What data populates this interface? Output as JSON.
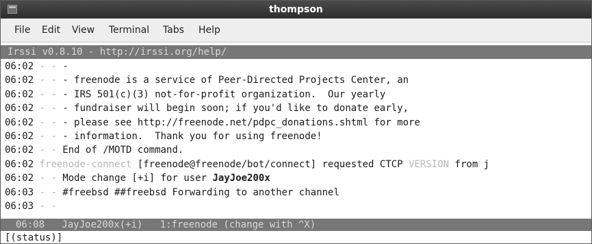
{
  "window": {
    "title": "thompson",
    "icon": "terminal-window-icon"
  },
  "menu": [
    "File",
    "Edit",
    "View",
    "Terminal",
    "Tabs",
    "Help"
  ],
  "topic_bar": "Irssi v0.8.10 - http://irssi.org/help/",
  "lines": [
    {
      "time": "06:02",
      "dashes": "- -",
      "text": "-"
    },
    {
      "time": "06:02",
      "dashes": "- -",
      "text": "- freenode is a service of Peer-Directed Projects Center, an"
    },
    {
      "time": "06:02",
      "dashes": "- -",
      "text": "- IRS 501(c)(3) not-for-profit organization.  Our yearly"
    },
    {
      "time": "06:02",
      "dashes": "- -",
      "text": "- fundraiser will begin soon; if you'd like to donate early,"
    },
    {
      "time": "06:02",
      "dashes": "- -",
      "text": "- please see http://freenode.net/pdpc_donations.shtml for more"
    },
    {
      "time": "06:02",
      "dashes": "- -",
      "text": "- information.  Thank you for using freenode!"
    },
    {
      "time": "06:02",
      "dashes": "- -",
      "text": "End of /MOTD command."
    },
    {
      "time": "06:02",
      "nick": "freenode-connect",
      "host": "[freenode@freenode/bot/connect]",
      "text": "requested CTCP",
      "ctcp": "VERSION",
      "tail": "from j"
    },
    {
      "time": "06:02",
      "dashes": "- -",
      "text": "Mode change [+i] for user",
      "user": "JayJoe200x"
    },
    {
      "time": "06:03",
      "dashes": "- -",
      "text": "#freebsd ##freebsd Forwarding to another channel"
    },
    {
      "time": "06:03",
      "dashes": "- -",
      "text": ""
    }
  ],
  "status_bar": "06:08   JayJoe200x(+i)   1:freenode (change with ^X)",
  "input_line": "[(status)]"
}
